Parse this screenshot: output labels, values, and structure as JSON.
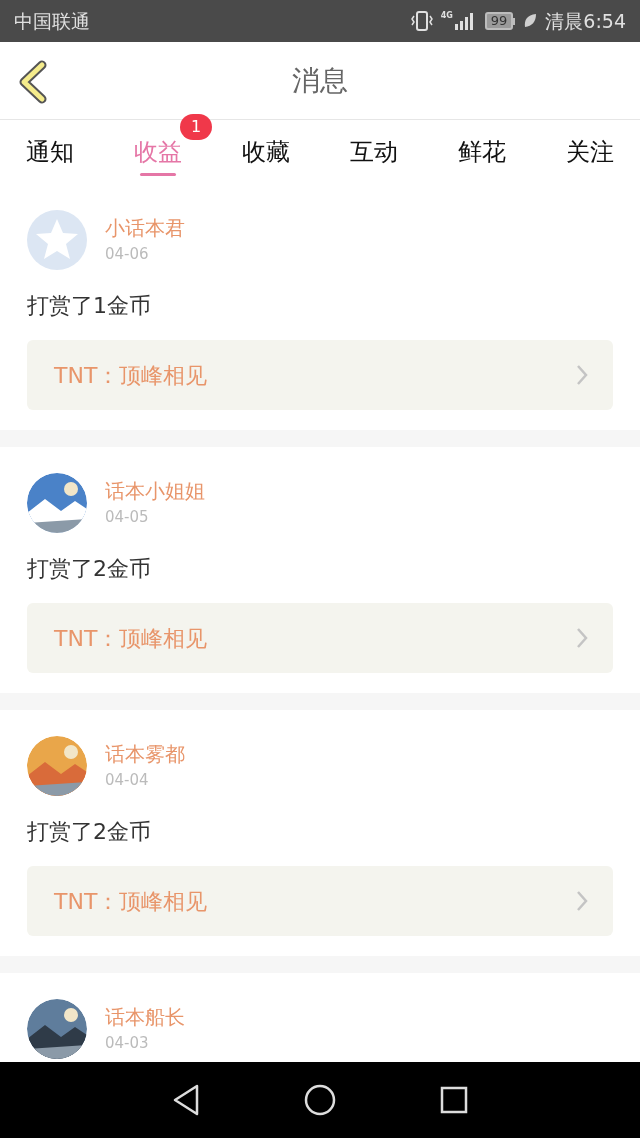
{
  "status_bar": {
    "carrier": "中国联通",
    "network": "4G",
    "battery": "99",
    "time": "清晨6:54"
  },
  "header": {
    "title": "消息"
  },
  "tabs": [
    {
      "label": "通知",
      "selected": false
    },
    {
      "label": "收益",
      "selected": true,
      "badge": "1"
    },
    {
      "label": "收藏",
      "selected": false
    },
    {
      "label": "互动",
      "selected": false
    },
    {
      "label": "鲜花",
      "selected": false
    },
    {
      "label": "关注",
      "selected": false
    }
  ],
  "messages": [
    {
      "kind": "default",
      "name": "小话本君",
      "date": "04-06",
      "text": "打赏了1金币",
      "link": "TNT：顶峰相见"
    },
    {
      "name": "话本小姐姐",
      "date": "04-05",
      "text": "打赏了2金币",
      "link": "TNT：顶峰相见"
    },
    {
      "name": "话本雾都",
      "date": "04-04",
      "text": "打赏了2金币",
      "link": "TNT：顶峰相见"
    },
    {
      "name": "话本船长",
      "date": "04-03"
    }
  ]
}
